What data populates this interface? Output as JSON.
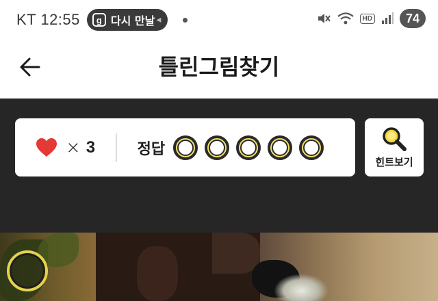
{
  "status_bar": {
    "carrier_time": "KT 12:55",
    "notification": {
      "app_icon_letter": "g",
      "text": "다시 만날",
      "icon": "notification-app-icon"
    },
    "hd_label": "HD",
    "battery": "74",
    "icons": [
      "mute-icon",
      "wifi-icon",
      "hd-voice-icon",
      "signal-icon",
      "battery-icon"
    ]
  },
  "header": {
    "title": "틀린그림찾기",
    "back_icon": "back-arrow-icon"
  },
  "game": {
    "lives": {
      "icon": "heart-icon",
      "times": "×",
      "count": "3",
      "color": "#e53935"
    },
    "answer_label": "정답",
    "answer_slots": [
      {
        "found": false
      },
      {
        "found": false
      },
      {
        "found": false
      },
      {
        "found": false
      },
      {
        "found": false
      }
    ],
    "slot_color": "#f1e06a",
    "hint": {
      "icon": "magnifier-icon",
      "label": "힌트보기",
      "icon_color": "#f4d93a"
    }
  },
  "colors": {
    "game_background": "#262626",
    "marker": "#e4d24b"
  }
}
